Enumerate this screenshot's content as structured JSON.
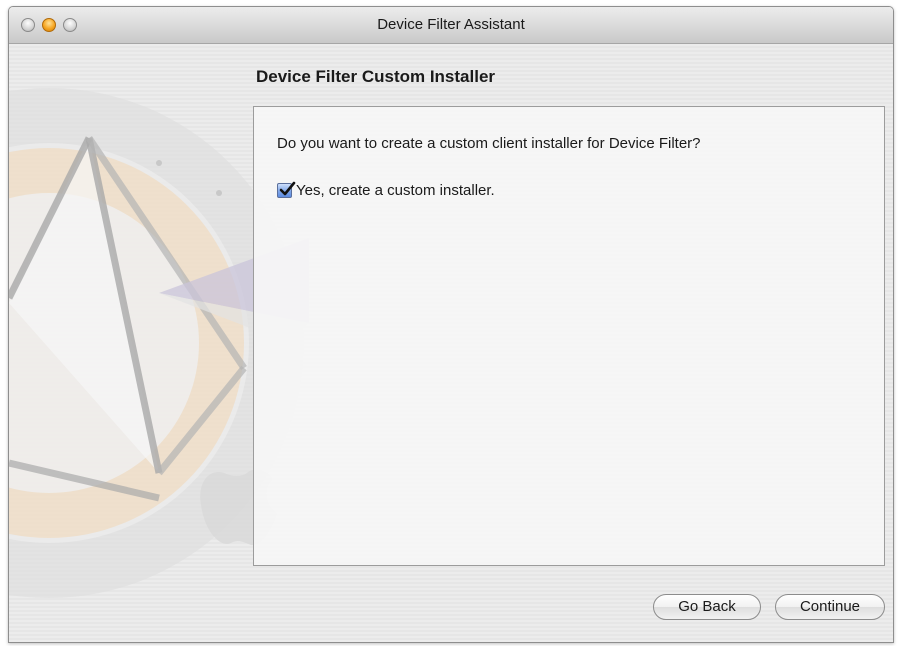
{
  "window": {
    "title": "Device Filter Assistant"
  },
  "section": {
    "title": "Device Filter Custom Installer"
  },
  "panel": {
    "question": "Do you want to create a custom client installer for Device Filter?",
    "checkbox": {
      "label": "Yes, create a custom installer.",
      "checked": true
    }
  },
  "buttons": {
    "back_label": "Go Back",
    "continue_label": "Continue"
  },
  "icons": {
    "traffic_lights": [
      "close-icon",
      "minimize-icon",
      "zoom-icon"
    ],
    "background": "device-filter-logo-icon"
  },
  "colors": {
    "accent_blue": "#5c8be0",
    "minimize_orange": "#f6a623"
  }
}
